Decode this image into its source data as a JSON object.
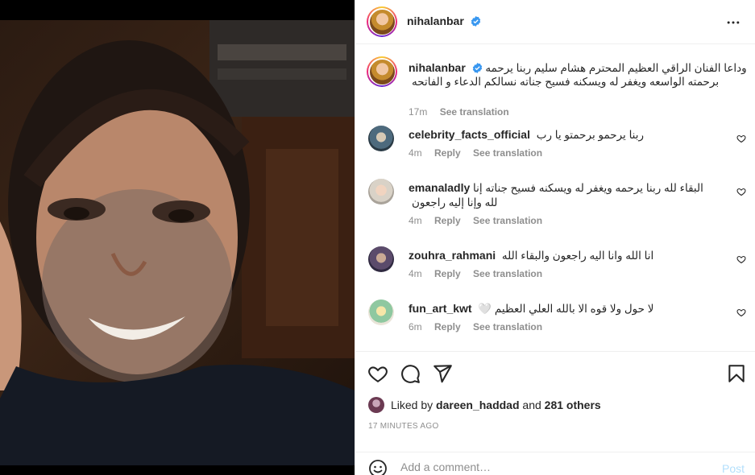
{
  "post": {
    "author": "nihalanbar",
    "caption_author": "nihalanbar",
    "caption_text": "وداعا الفنان الراقي العظيم المحترم هشام سليم ربنا يرحمه برحمته الواسعه ويغفر له ويسكنه فسيح جناته نسالكم الدعاء و الفاتحه",
    "caption_time": "17m",
    "see_translation": "See translation",
    "liked_by_prefix": "Liked by",
    "liked_by_user": "dareen_haddad",
    "liked_by_and": "and",
    "liked_by_others": "281 others",
    "timestamp": "17 MINUTES AGO",
    "comment_placeholder": "Add a comment…",
    "post_button": "Post"
  },
  "comments": [
    {
      "user": "celebrity_facts_official",
      "text": "ربنا يرحمو برحمتو يا رب",
      "time": "4m",
      "reply": "Reply",
      "translate": "See translation"
    },
    {
      "user": "emanaladly",
      "text": "البقاء لله ربنا يرحمه ويغفر له ويسكنه فسيح جناته إنا لله وإنا إليه راجعون",
      "time": "4m",
      "reply": "Reply",
      "translate": "See translation"
    },
    {
      "user": "zouhra_rahmani",
      "text": "انا الله وانا اليه راجعون والبقاء الله",
      "time": "4m",
      "reply": "Reply",
      "translate": "See translation"
    },
    {
      "user": "fun_art_kwt",
      "text": "لا حول ولا قوه الا بالله العلي العظيم 🤍",
      "time": "6m",
      "reply": "Reply",
      "translate": "See translation"
    }
  ],
  "colors": {
    "verified": "#3897f0",
    "post_disabled": "#b2dffc",
    "meta_gray": "#8e8e8e"
  },
  "icons": [
    "more-icon",
    "verified-icon",
    "heart-icon",
    "comment-icon",
    "share-icon",
    "bookmark-icon",
    "emoji-icon"
  ]
}
